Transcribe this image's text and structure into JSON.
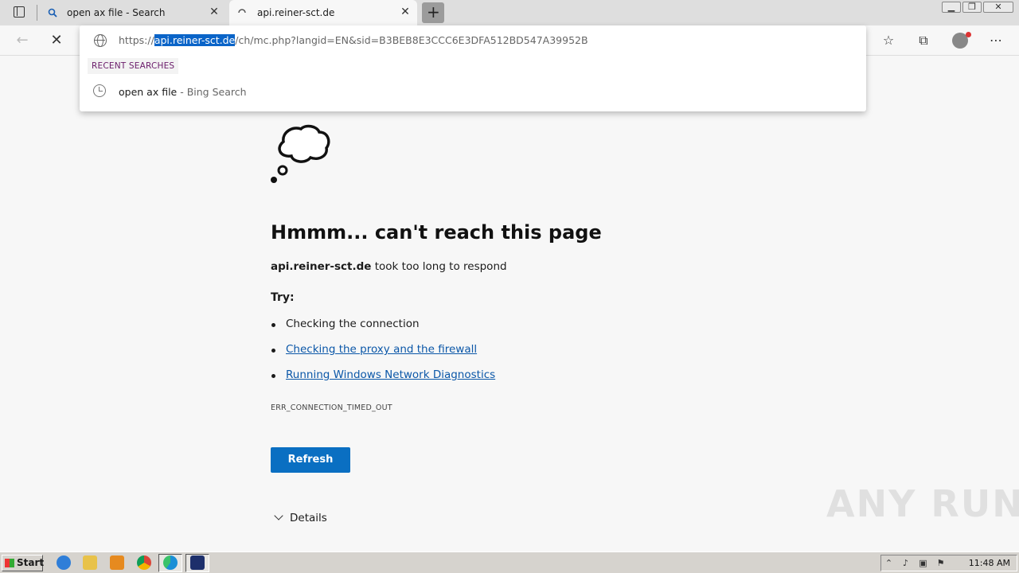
{
  "tabs": [
    {
      "title": "open ax file - Search",
      "icon": "search-icon"
    },
    {
      "title": "api.reiner-sct.de",
      "icon": "loading-spinner-icon"
    }
  ],
  "toolbar": {
    "url_prefix": "https://",
    "url_host": "api.reiner-sct.de",
    "url_rest": "/ch/mc.php?langid=EN&sid=B3BEB8E3CCC6E3DFA512BD547A39952B"
  },
  "omnibox": {
    "recent_label": "RECENT SEARCHES",
    "suggestion_text": "open ax file",
    "suggestion_source": " - Bing Search"
  },
  "error_page": {
    "title": "Hmmm... can't reach this page",
    "host": "api.reiner-sct.de",
    "message": " took too long to respond",
    "try_label": "Try:",
    "tips": [
      "Checking the connection",
      "Checking the proxy and the firewall",
      "Running Windows Network Diagnostics"
    ],
    "error_code": "ERR_CONNECTION_TIMED_OUT",
    "refresh_label": "Refresh",
    "details_label": "Details"
  },
  "watermark": "ANY RUN",
  "taskbar": {
    "start_label": "Start",
    "clock": "11:48 AM"
  },
  "colors": {
    "accent": "#0a6fc2",
    "link": "#0b57a8",
    "selection": "#0a64c8"
  }
}
